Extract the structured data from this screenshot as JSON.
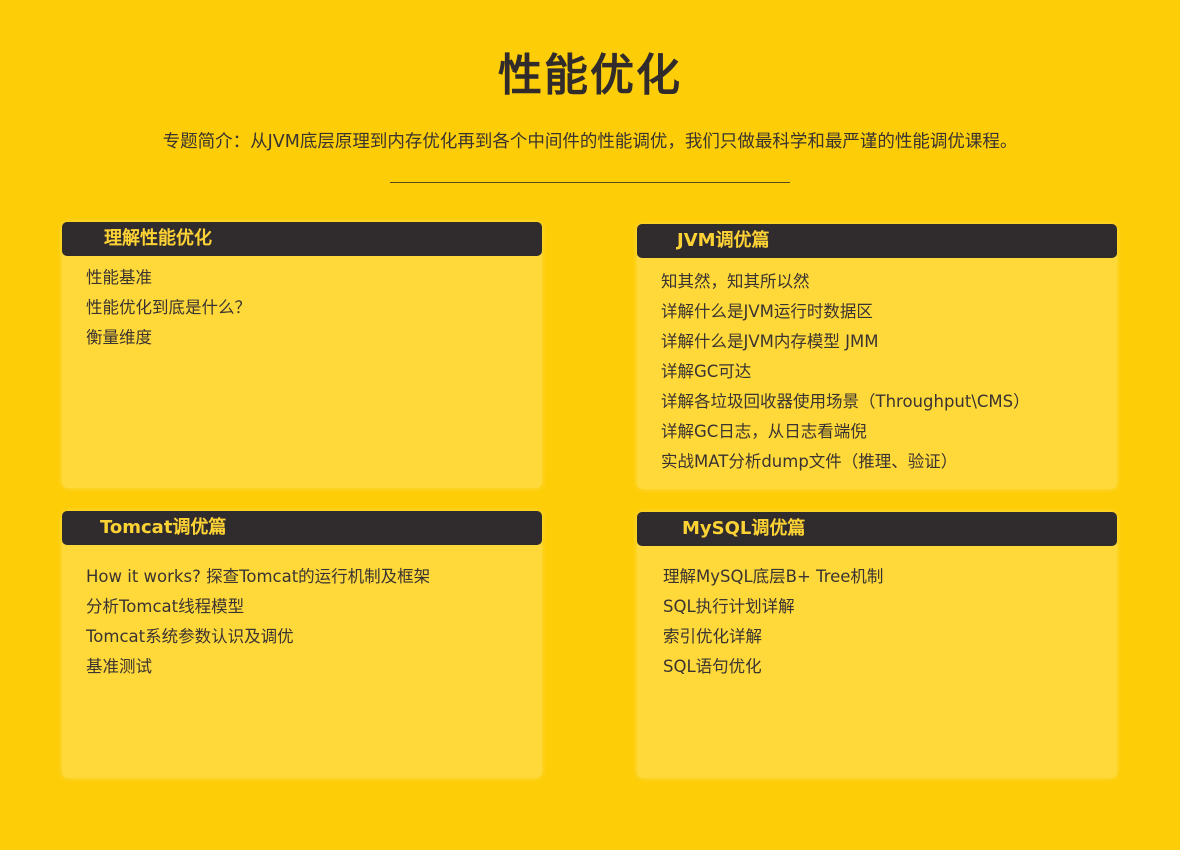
{
  "page": {
    "title": "性能优化",
    "intro": "专题简介：从JVM底层原理到内存优化再到各个中间件的性能调优，我们只做最科学和最严谨的性能调优课程。"
  },
  "sections": [
    {
      "heading": "理解性能优化",
      "items": [
        "性能基准",
        "性能优化到底是什么？",
        "衡量维度"
      ]
    },
    {
      "heading": "JVM调优篇",
      "items": [
        "知其然，知其所以然",
        "详解什么是JVM运行时数据区",
        "详解什么是JVM内存模型 JMM",
        "详解GC可达",
        "详解各垃圾回收器使用场景（Throughput\\CMS）",
        "详解GC日志，从日志看端倪",
        "实战MAT分析dump文件（推理、验证）"
      ]
    },
    {
      "heading": "Tomcat调优篇",
      "items": [
        "How it works? 探查Tomcat的运行机制及框架",
        "分析Tomcat线程模型",
        "Tomcat系统参数认识及调优",
        "基准测试"
      ]
    },
    {
      "heading": "MySQL调优篇",
      "items": [
        "理解MySQL底层B+ Tree机制",
        "SQL执行计划详解",
        "索引优化详解",
        "SQL语句优化"
      ]
    }
  ],
  "colors": {
    "background": "#fdcd07",
    "card": "#ffd83a",
    "header_bar": "#302c2e",
    "header_text": "#fdd234",
    "body_text": "#3a3431"
  }
}
